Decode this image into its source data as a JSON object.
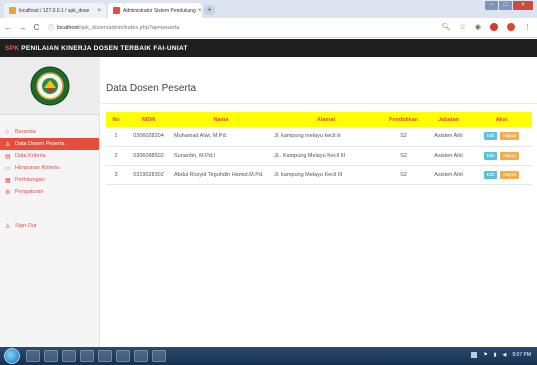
{
  "browser": {
    "tabs": [
      {
        "label": "localhost / 127.0.0.1 / spk_dose"
      },
      {
        "label": "Administrator Sistem Pendukung"
      }
    ],
    "address": {
      "host": "localhost",
      "path": "/spk_dosen/admin/index.php?ap=peserta"
    }
  },
  "app": {
    "abbr": "SPK",
    "title": "PENILAIAN KINERJA DOSEN TERBAIK FAI-UNIAT"
  },
  "sidebar": {
    "items": [
      {
        "label": "Beranda",
        "icon": "home-icon"
      },
      {
        "label": "Data Dosen Peserta",
        "icon": "user-icon"
      },
      {
        "label": "Data Kriteria",
        "icon": "list-icon"
      },
      {
        "label": "Himpunan Kriteria",
        "icon": "folder-icon"
      },
      {
        "label": "Perhitungan",
        "icon": "calculator-icon"
      },
      {
        "label": "Pengaturan",
        "icon": "gear-icon"
      }
    ],
    "signout": {
      "label": "Sign Out",
      "icon": "user-icon"
    }
  },
  "main": {
    "page_title": "Data Dosen Peserta",
    "table": {
      "headers": [
        "No",
        "NIDN",
        "Nama",
        "Alamat",
        "Pendidikan",
        "Jabatan",
        "Aksi"
      ],
      "rows": [
        {
          "no": "1",
          "nidn": "0306028204",
          "nama": "Muhamad Alwi, M.Pd.",
          "alamat": "Jl. kampung melayu kecil iii",
          "pendidikan": "S2",
          "jabatan": "Asisten Ahli",
          "edit": "Edit",
          "hapus": "Hapus"
        },
        {
          "no": "2",
          "nidn": "0306098502",
          "nama": "Sunardin, M.Pd.I",
          "alamat": "JL. Kampung Melayu Kecil III",
          "pendidikan": "S2",
          "jabatan": "Asisten Ahli",
          "edit": "Edit",
          "hapus": "Hapus"
        },
        {
          "no": "3",
          "nidn": "0319028302",
          "nama": "Abdul Rosyid Teguhdin Hamid.M.Pd.",
          "alamat": "Jl. kampung Melayu Kecil III",
          "pendidikan": "S2",
          "jabatan": "Asisten Ahli",
          "edit": "Edit",
          "hapus": "Hapus"
        }
      ]
    }
  },
  "taskbar": {
    "time": "9:07 PM"
  },
  "colors": {
    "accent": "#e74c3c",
    "header_bg": "#1f1f1f",
    "table_head_bg": "#ffff00",
    "edit_btn": "#5bc0de",
    "hapus_btn": "#f0ad4e"
  }
}
